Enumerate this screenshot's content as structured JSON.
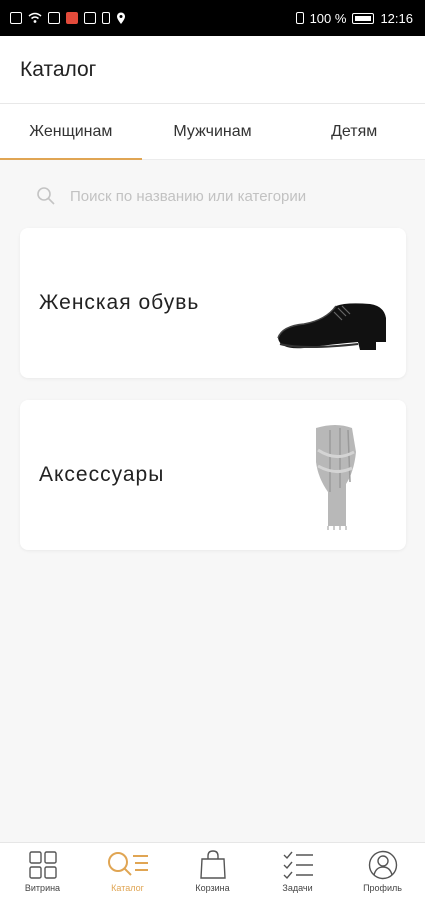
{
  "status_bar": {
    "battery_text": "100 %",
    "time": "12:16"
  },
  "header": {
    "title": "Каталог"
  },
  "tabs": [
    {
      "label": "Женщинам",
      "active": true
    },
    {
      "label": "Мужчинам",
      "active": false
    },
    {
      "label": "Детям",
      "active": false
    }
  ],
  "search": {
    "placeholder": "Поиск по названию или категории"
  },
  "categories": [
    {
      "title": "Женская обувь",
      "image": "shoe-image"
    },
    {
      "title": "Аксессуары",
      "image": "scarf-image"
    }
  ],
  "bottom_nav": [
    {
      "label": "Витрина",
      "icon": "grid-icon",
      "active": false
    },
    {
      "label": "Каталог",
      "icon": "catalog-search-icon",
      "active": true
    },
    {
      "label": "Корзина",
      "icon": "shopping-bag-icon",
      "active": false
    },
    {
      "label": "Задачи",
      "icon": "checklist-icon",
      "active": false
    },
    {
      "label": "Профиль",
      "icon": "profile-icon",
      "active": false
    }
  ],
  "colors": {
    "accent": "#e0a553",
    "background": "#f7f7f7",
    "card": "#ffffff"
  }
}
